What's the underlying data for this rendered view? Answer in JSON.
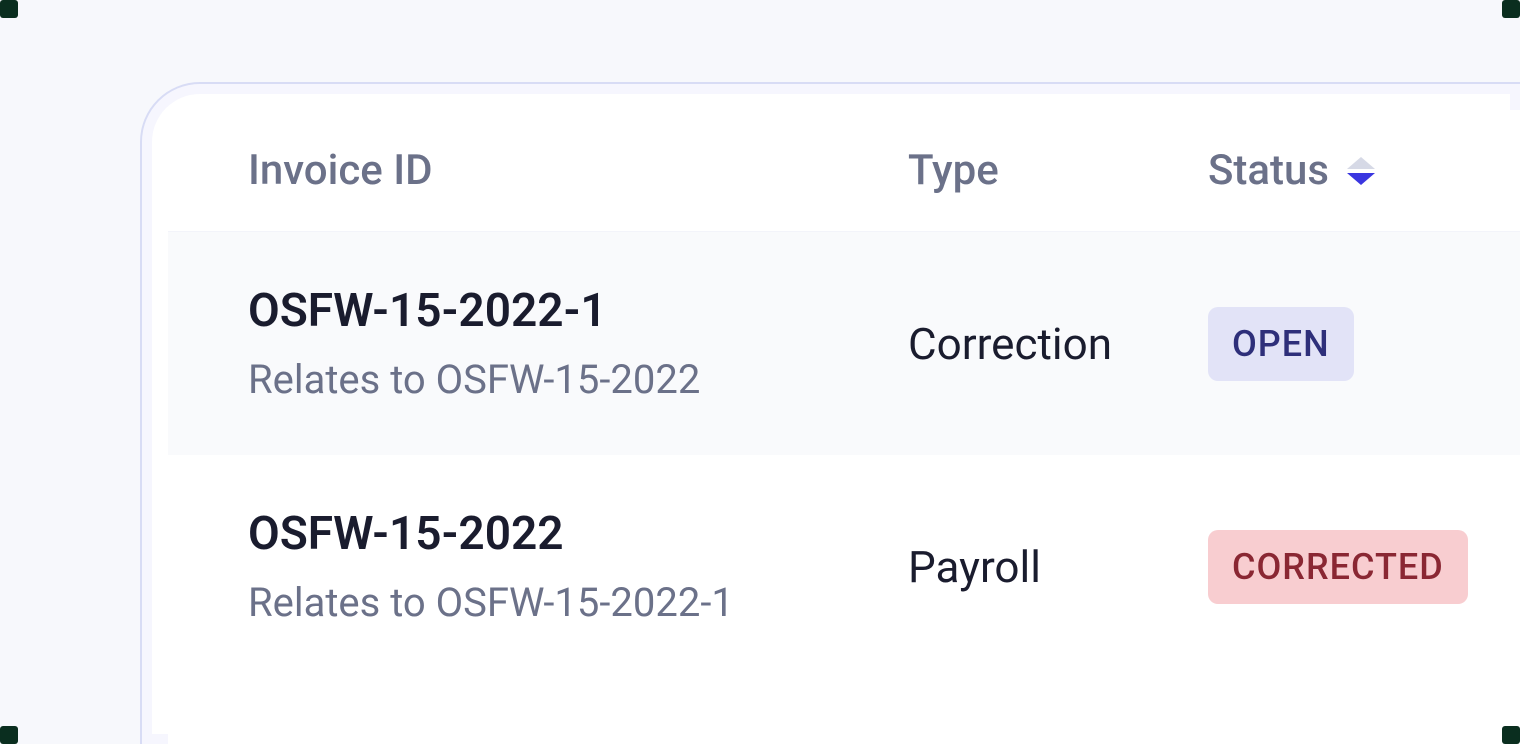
{
  "table": {
    "headers": {
      "invoice_id": "Invoice ID",
      "type": "Type",
      "status": "Status"
    },
    "rows": [
      {
        "invoice_id": "OSFW-15-2022-1",
        "relates_to": "Relates to OSFW-15-2022",
        "type": "Correction",
        "status": "OPEN",
        "status_variant": "open",
        "highlighted": true
      },
      {
        "invoice_id": "OSFW-15-2022",
        "relates_to": "Relates to OSFW-15-2022-1",
        "type": "Payroll",
        "status": "CORRECTED",
        "status_variant": "corrected",
        "highlighted": false
      }
    ]
  }
}
